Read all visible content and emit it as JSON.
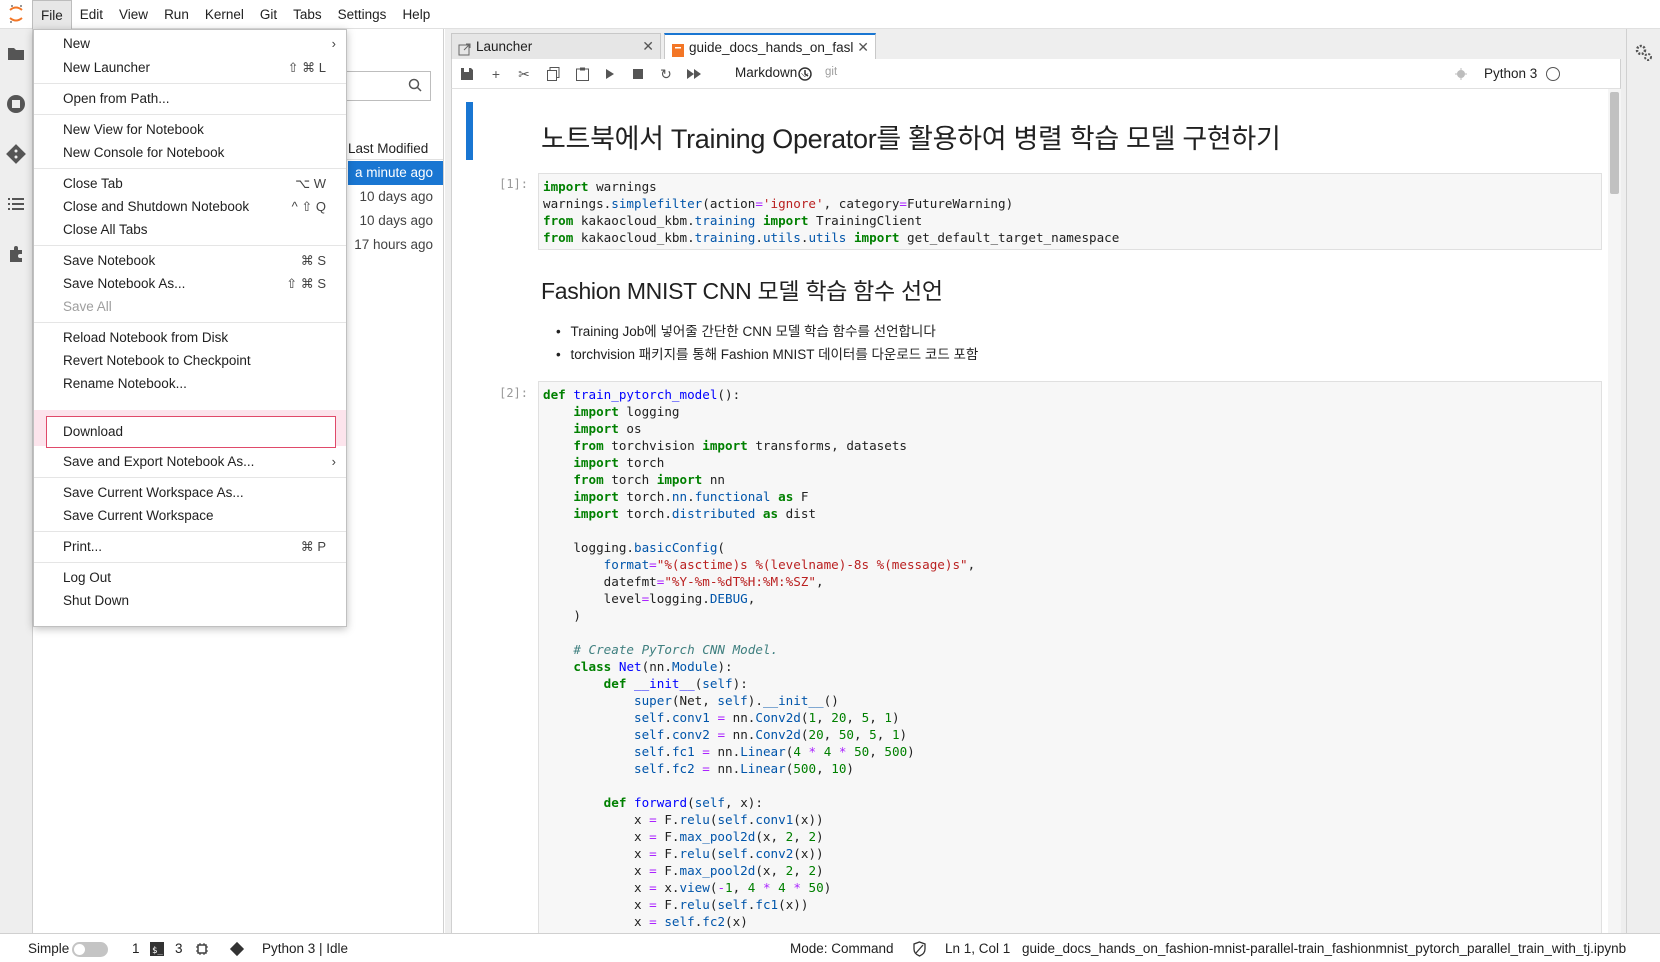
{
  "menubar": {
    "items": [
      "File",
      "Edit",
      "View",
      "Run",
      "Kernel",
      "Git",
      "Tabs",
      "Settings",
      "Help"
    ]
  },
  "file_menu": {
    "items": [
      {
        "label": "New",
        "submenu": true
      },
      {
        "label": "New Launcher",
        "shortcut": "⇧ ⌘ L"
      },
      {
        "label": "Open from Path..."
      },
      {
        "label": "New View for Notebook"
      },
      {
        "label": "New Console for Notebook"
      },
      {
        "label": "Close Tab",
        "shortcut": "⌥ W"
      },
      {
        "label": "Close and Shutdown Notebook",
        "shortcut": "^ ⇧ Q"
      },
      {
        "label": "Close All Tabs"
      },
      {
        "label": "Save Notebook",
        "shortcut": "⌘ S"
      },
      {
        "label": "Save Notebook As...",
        "shortcut": "⇧ ⌘ S"
      },
      {
        "label": "Save All",
        "disabled": true
      },
      {
        "label": "Reload Notebook from Disk"
      },
      {
        "label": "Revert Notebook to Checkpoint"
      },
      {
        "label": "Rename Notebook..."
      },
      {
        "label": "Download",
        "highlighted": true
      },
      {
        "label": "Save and Export Notebook As...",
        "submenu": true
      },
      {
        "label": "Save Current Workspace As..."
      },
      {
        "label": "Save Current Workspace"
      },
      {
        "label": "Print...",
        "shortcut": "⌘ P"
      },
      {
        "label": "Log Out"
      },
      {
        "label": "Shut Down"
      }
    ]
  },
  "file_browser": {
    "column_header": "Last Modified",
    "rows": [
      "a minute ago",
      "10 days ago",
      "10 days ago",
      "17 hours ago"
    ]
  },
  "tabs": [
    {
      "label": "Launcher"
    },
    {
      "label": "guide_docs_hands_on_fasl"
    }
  ],
  "toolbar": {
    "cell_type": "Markdown",
    "git": "git",
    "kernel": "Python 3"
  },
  "notebook": {
    "title": "노트북에서 Training Operator를 활용하여 병렬 학습 모델 구현하기",
    "cell1_prompt": "[1]:",
    "section_heading": "Fashion MNIST CNN 모델 학습 함수 선언",
    "bullets": [
      "Training Job에 넣어줄 간단한 CNN 모델 학습 함수를 선언합니다",
      "torchvision 패키지를 통해 Fashion MNIST 데이터를 다운로드 코드 포함"
    ],
    "cell2_prompt": "[2]:"
  },
  "statusbar": {
    "mode_label": "Simple",
    "terminals": "1",
    "kernels": "3",
    "kernel_status": "Python 3 | Idle",
    "mode": "Mode: Command",
    "cursor": "Ln 1, Col 1",
    "filename": "guide_docs_hands_on_fashion-mnist-parallel-train_fashionmnist_pytorch_parallel_train_with_tj.ipynb"
  },
  "colors": {
    "accent": "#1976d2",
    "highlight_border": "#e04a6a",
    "highlight_bg": "#fce4ec"
  }
}
